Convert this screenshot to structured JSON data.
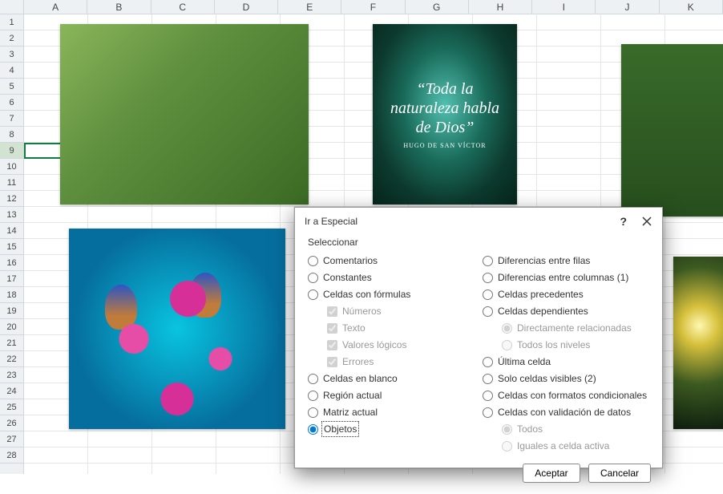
{
  "sheet": {
    "columns": [
      "A",
      "B",
      "C",
      "D",
      "E",
      "F",
      "G",
      "H",
      "I",
      "J",
      "K"
    ],
    "rows": [
      "1",
      "2",
      "3",
      "4",
      "5",
      "6",
      "7",
      "8",
      "9",
      "10",
      "11",
      "12",
      "13",
      "14",
      "15",
      "16",
      "17",
      "18",
      "19",
      "20",
      "21",
      "22",
      "23",
      "24",
      "25",
      "26",
      "27",
      "28"
    ],
    "active_row_index": 8
  },
  "images": {
    "pic2_quote": "“Toda la naturaleza habla de Dios”",
    "pic2_author": "HUGO DE SAN VÍCTOR"
  },
  "dialog": {
    "title": "Ir a Especial",
    "help_label": "?",
    "section": "Seleccionar",
    "left": {
      "comments": "Comentarios",
      "constants": "Constantes",
      "formulas": "Celdas con fórmulas",
      "numbers": "Números",
      "text": "Texto",
      "logicals": "Valores lógicos",
      "errors": "Errores",
      "blanks": "Celdas en blanco",
      "region": "Región actual",
      "matrix": "Matriz actual",
      "objects": "Objetos"
    },
    "right": {
      "rowdiff": "Diferencias entre filas",
      "coldiff": "Diferencias entre columnas (1)",
      "precedents": "Celdas precedentes",
      "dependents": "Celdas dependientes",
      "direct": "Directamente relacionadas",
      "alllevels": "Todos los niveles",
      "lastcell": "Última celda",
      "visible": "Solo celdas visibles (2)",
      "condformat": "Celdas con formatos condicionales",
      "validation": "Celdas con validación de datos",
      "all": "Todos",
      "same": "Iguales a celda activa"
    },
    "selected": "objects",
    "accept": "Aceptar",
    "cancel": "Cancelar"
  }
}
